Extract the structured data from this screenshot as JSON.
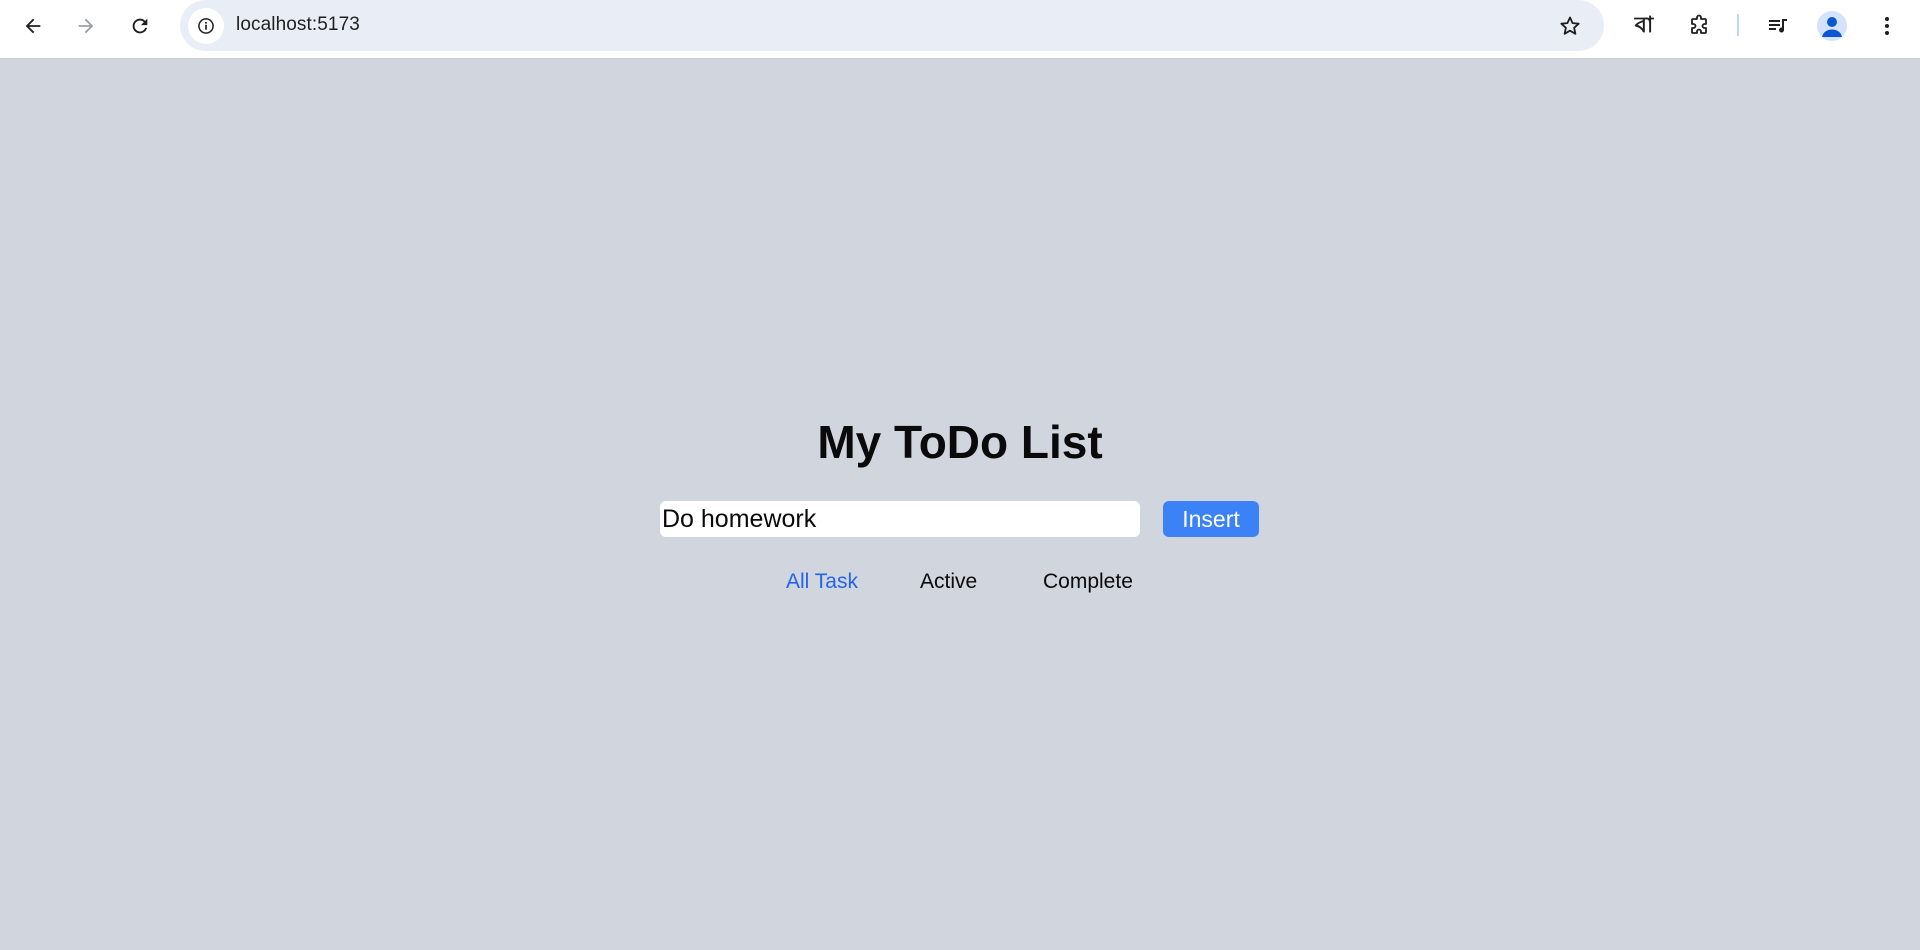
{
  "browser": {
    "url": "localhost:5173",
    "language_badge": "বা",
    "icons": {
      "back": "back-arrow-icon",
      "forward": "forward-arrow-icon",
      "reload": "reload-icon",
      "site_info": "info-icon",
      "bookmark": "star-icon",
      "extensions": "puzzle-icon",
      "media": "playlist-icon",
      "profile": "person-icon",
      "menu": "kebab-menu-icon"
    }
  },
  "app": {
    "title": "My ToDo List",
    "input_value": "Do homework",
    "insert_label": "Insert",
    "filters": [
      {
        "label": "All Task",
        "selected": true
      },
      {
        "label": "Active",
        "selected": false
      },
      {
        "label": "Complete",
        "selected": false
      }
    ],
    "colors": {
      "page_background": "#d1d5de",
      "insert_button": "#3b82f6",
      "selected_filter": "#2563eb"
    }
  }
}
